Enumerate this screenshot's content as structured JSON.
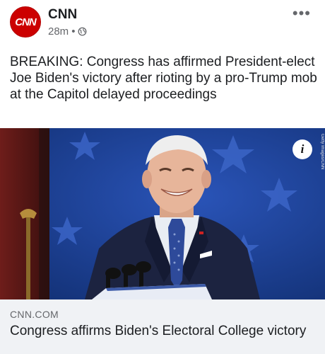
{
  "header": {
    "avatar_text": "CNN",
    "page_name": "CNN",
    "timestamp": "28m",
    "separator": "•",
    "audience_icon": "globe-icon",
    "more_label": "•••"
  },
  "post": {
    "text": "BREAKING: Congress has affirmed President-elect Joe Biden's victory after rioting by a pro-Trump mob at the Capitol delayed proceedings"
  },
  "media": {
    "info_label": "i",
    "credit_text": "Getty Images/CNN"
  },
  "link_preview": {
    "domain": "CNN.COM",
    "title": "Congress affirms Biden's Electoral College victory"
  },
  "colors": {
    "brand": "#cc0000",
    "backdrop_blue": "#1b3a8c",
    "preview_bg": "#f0f2f5",
    "secondary_text": "#65676b"
  }
}
